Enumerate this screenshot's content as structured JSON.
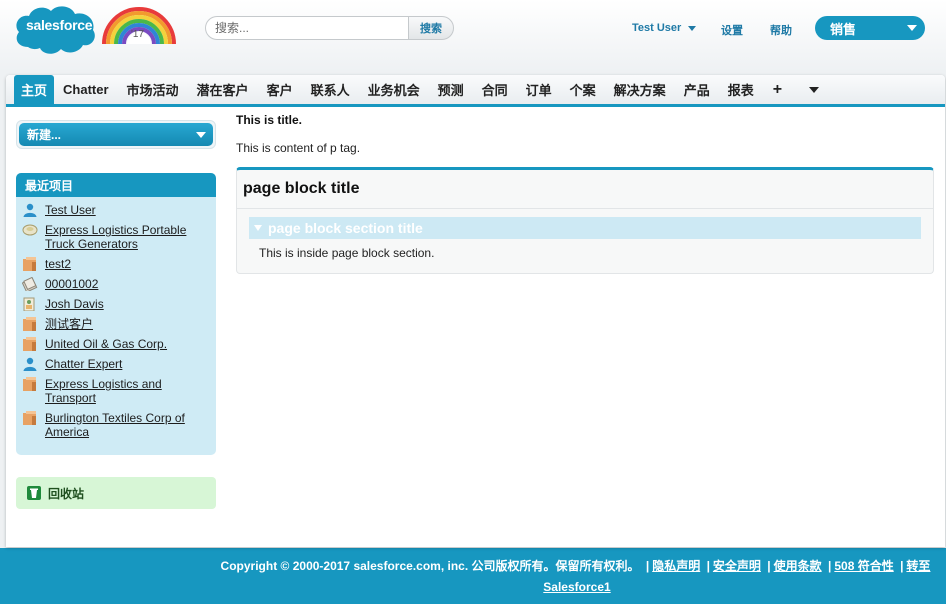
{
  "header": {
    "logo_text": "salesforce",
    "rainbow_text": "'17",
    "search_placeholder": "搜索...",
    "search_button": "搜索",
    "user_name": "Test User",
    "settings": "设置",
    "help": "帮助",
    "app_name": "销售",
    "colors": {
      "brand": "#1797c0",
      "link": "#1f7aa6"
    }
  },
  "tabs": [
    {
      "label": "主页",
      "active": true
    },
    {
      "label": "Chatter"
    },
    {
      "label": "市场活动"
    },
    {
      "label": "潜在客户"
    },
    {
      "label": "客户"
    },
    {
      "label": "联系人"
    },
    {
      "label": "业务机会"
    },
    {
      "label": "预测"
    },
    {
      "label": "合同"
    },
    {
      "label": "订单"
    },
    {
      "label": "个案"
    },
    {
      "label": "解决方案"
    },
    {
      "label": "产品"
    },
    {
      "label": "报表"
    }
  ],
  "tab_icons": {
    "plus": "+",
    "more": "chevron-down-icon"
  },
  "sidebar": {
    "create_new": "新建...",
    "recent_title": "最近项目",
    "recent_items": [
      {
        "label": "Test User",
        "icon": "user-icon"
      },
      {
        "label": "Express Logistics Portable Truck Generators",
        "icon": "opportunity-icon"
      },
      {
        "label": "test2",
        "icon": "account-icon"
      },
      {
        "label": "00001002",
        "icon": "case-icon"
      },
      {
        "label": "Josh Davis",
        "icon": "contact-icon"
      },
      {
        "label": "测试客户",
        "icon": "account-icon"
      },
      {
        "label": "United Oil & Gas Corp.",
        "icon": "account-icon"
      },
      {
        "label": "Chatter Expert",
        "icon": "user-icon"
      },
      {
        "label": "Express Logistics and Transport",
        "icon": "account-icon"
      },
      {
        "label": "Burlington Textiles Corp of America",
        "icon": "account-icon"
      }
    ],
    "recycle_bin": "回收站"
  },
  "content": {
    "title": "This is title.",
    "paragraph": "This is content of p tag.",
    "page_block_title": "page block title",
    "section_title": "page block section title",
    "section_body": "This is inside page block section."
  },
  "footer": {
    "copyright": "Copyright © 2000-2017 salesforce.com, inc. 公司版权所有。保留所有权利。",
    "links": [
      "隐私声明",
      "安全声明",
      "使用条款",
      "508 符合性",
      "转至"
    ],
    "salesforce1": "Salesforce1"
  }
}
